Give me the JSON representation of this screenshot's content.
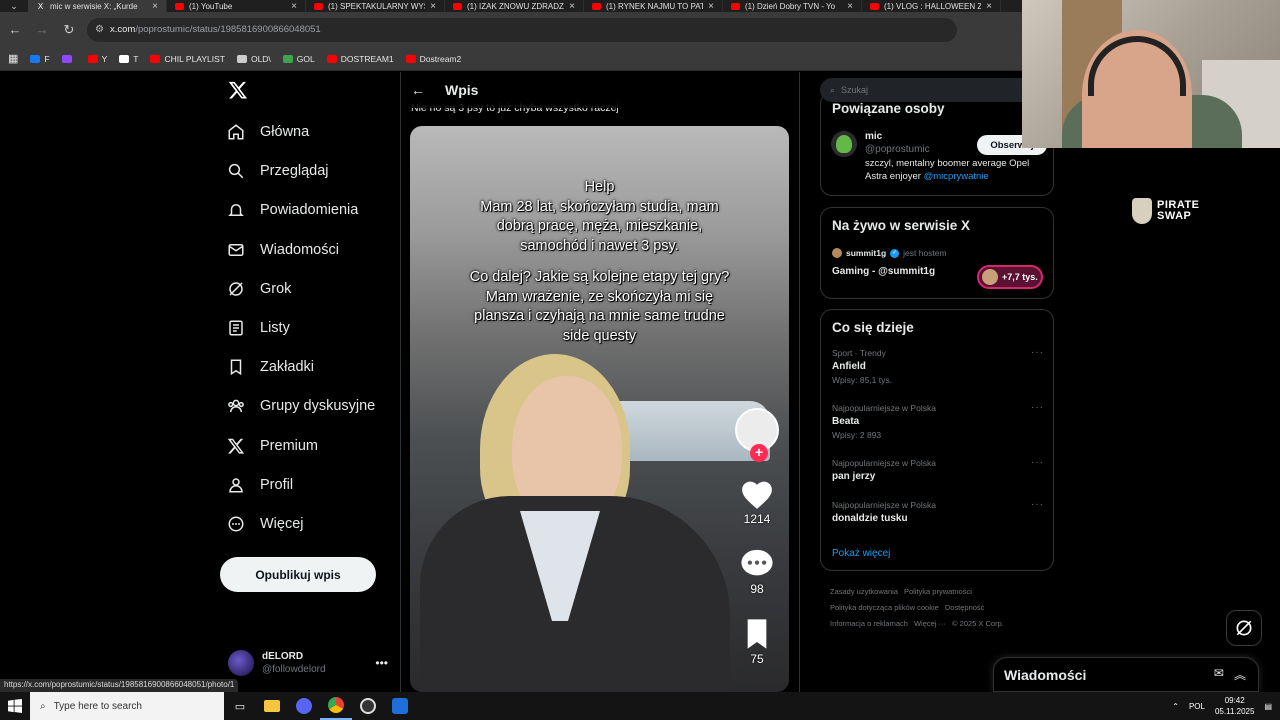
{
  "browser": {
    "tabs": [
      {
        "label": "mic w serwisie X: „Kurde",
        "icon": "x-icon",
        "active": true
      },
      {
        "label": "(1) YouTube",
        "icon": "youtube-icon",
        "active": false
      },
      {
        "label": "(1) SPEKTAKULARNY WYS",
        "icon": "youtube-icon",
        "active": false
      },
      {
        "label": "(1) IZAK ZNOWU ZDRADZ",
        "icon": "youtube-icon",
        "active": false
      },
      {
        "label": "(1) RYNEK NAJMU TO PAT",
        "icon": "youtube-icon",
        "active": false
      },
      {
        "label": "(1) Dzień Dobry TVN - Yo",
        "icon": "youtube-icon",
        "active": false
      },
      {
        "label": "(1) VLOG : HALLOWEEN Z",
        "icon": "youtube-icon",
        "active": false
      }
    ],
    "url_host": "x.com",
    "url_path": "/poprostumic/status/1985816900866048051",
    "bookmarks": [
      {
        "label": "F",
        "color": "#1877f2"
      },
      {
        "label": "",
        "color": "#9146ff"
      },
      {
        "label": "Y",
        "color": "#ff0000"
      },
      {
        "label": "T",
        "color": "#ffffff"
      },
      {
        "label": "CHIL PLAYLIST",
        "color": "#ff0000"
      },
      {
        "label": "OLD\\",
        "color": "#cccccc"
      },
      {
        "label": "GOL",
        "color": "#3fa34d"
      },
      {
        "label": "DOSTREAM1",
        "color": "#ff0000"
      },
      {
        "label": "Dostream2",
        "color": "#ff0000"
      }
    ],
    "status_url": "https://x.com/poprostumic/status/1985816900866048051/photo/1"
  },
  "nav": {
    "items": [
      {
        "label": "Główna",
        "icon": "home-icon"
      },
      {
        "label": "Przeglądaj",
        "icon": "search-icon"
      },
      {
        "label": "Powiadomienia",
        "icon": "bell-icon"
      },
      {
        "label": "Wiadomości",
        "icon": "mail-icon"
      },
      {
        "label": "Grok",
        "icon": "grok-icon"
      },
      {
        "label": "Listy",
        "icon": "list-icon"
      },
      {
        "label": "Zakładki",
        "icon": "bookmark-icon"
      },
      {
        "label": "Grupy dyskusyjne",
        "icon": "community-icon"
      },
      {
        "label": "Premium",
        "icon": "x-icon"
      },
      {
        "label": "Profil",
        "icon": "profile-icon"
      },
      {
        "label": "Więcej",
        "icon": "more-icon"
      }
    ],
    "post_button": "Opublikuj wpis",
    "account_name": "dELORD",
    "account_handle": "@followdelord"
  },
  "main": {
    "title": "Wpis",
    "post_text": "Nie no są 3 psy to już chyba wszystko raczej",
    "caption_lines_1": [
      "Help",
      "Mam 28 lat, skończyłam studia, mam",
      "dobrą pracę, męża, mieszkanie,",
      "samochód i nawet 3 psy."
    ],
    "caption_lines_2": [
      "Co dalej? Jakie są kolejne etapy tej gry?",
      "Mam wrażenie, ze skończyła mi się",
      "plansza i czyhają na mnie same trudne",
      "side questy"
    ],
    "likes": "1214",
    "comments": "98",
    "saves": "75"
  },
  "right": {
    "search_placeholder": "Szukaj",
    "related_title": "Powiązane osoby",
    "related_name": "mic",
    "related_handle": "@poprostumic",
    "related_bio": "szczyl, mentalny boomer average Opel Astra enjoyer ",
    "related_bio_link": "@micprywatnie",
    "follow_label": "Obserwuj",
    "live_title": "Na żywo w serwisie X",
    "live_host_name": "summit1g",
    "live_host_role": "jest hostem",
    "live_stream_title": "Gaming - @summit1g",
    "live_viewers": "+7,7 tys.",
    "trends_title": "Co się dzieje",
    "trends": [
      {
        "category": "Sport · Trendy",
        "name": "Anfield",
        "posts": "Wpisy: 85,1 tys."
      },
      {
        "category": "Najpopularniejsze w Polska",
        "name": "Beata",
        "posts": "Wpisy: 2 893"
      },
      {
        "category": "Najpopularniejsze w Polska",
        "name": "pan jerzy",
        "posts": ""
      },
      {
        "category": "Najpopularniejsze w Polska",
        "name": "donaldzie tusku",
        "posts": ""
      }
    ],
    "show_more": "Pokaż więcej",
    "footer_links": [
      "Zasady użytkowania",
      "Polityka prywatności",
      "Polityka dotycząca plików cookie",
      "Dostępność",
      "Informacja o reklamach",
      "Więcej ···",
      "© 2025 X Corp."
    ],
    "ad_text_1": "PIRATE",
    "ad_text_2": "SWAP",
    "messages_title": "Wiadomości"
  },
  "taskbar": {
    "search_placeholder": "Type here to search",
    "lang": "POL",
    "time": "09:42",
    "date": "05.11.2025"
  }
}
